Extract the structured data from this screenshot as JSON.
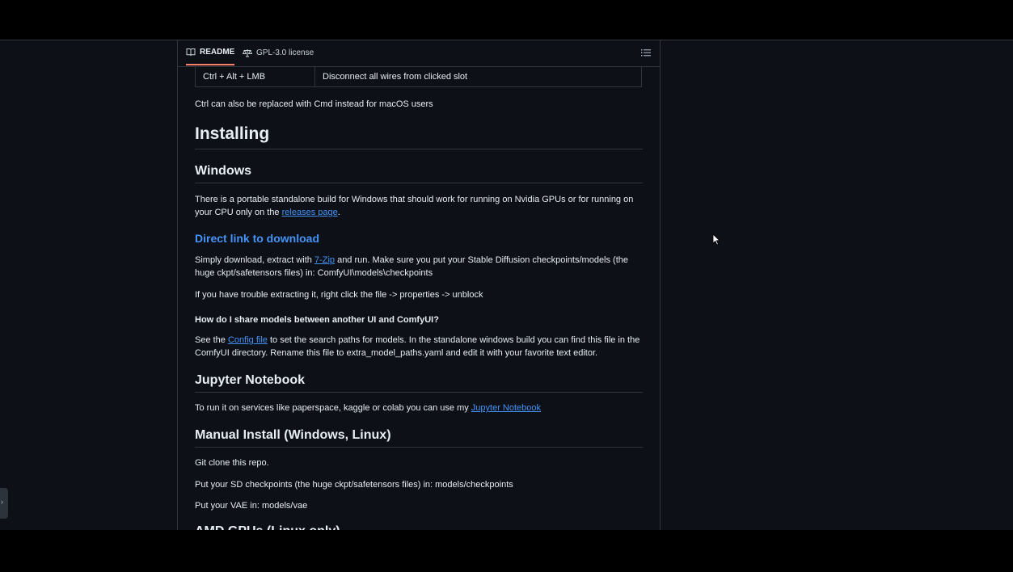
{
  "tabs": {
    "readme_label": "README",
    "license_label": "GPL-3.0 license"
  },
  "shortcut_row": {
    "key": "Ctrl + Alt + LMB",
    "description": "Disconnect all wires from clicked slot"
  },
  "readme": {
    "ctrl_note": "Ctrl can also be replaced with Cmd instead for macOS users",
    "installing_heading": "Installing",
    "windows_heading": "Windows",
    "windows_text_1": "There is a portable standalone build for Windows that should work for running on Nvidia GPUs or for running on your CPU only on the ",
    "releases_link": "releases page",
    "windows_text_end": ".",
    "direct_link_heading": "Direct link to download",
    "download_text_1": "Simply download, extract with ",
    "zip_link": "7-Zip",
    "download_text_2": " and run. Make sure you put your Stable Diffusion checkpoints/models (the huge ckpt/safetensors files) in: ComfyUI\\models\\checkpoints",
    "trouble_text": "If you have trouble extracting it, right click the file -> properties -> unblock",
    "share_heading": "How do I share models between another UI and ComfyUI?",
    "config_text_1": "See the ",
    "config_link": "Config file",
    "config_text_2": " to set the search paths for models. In the standalone windows build you can find this file in the ComfyUI directory. Rename this file to extra_model_paths.yaml and edit it with your favorite text editor.",
    "jupyter_heading": "Jupyter Notebook",
    "jupyter_text": "To run it on services like paperspace, kaggle or colab you can use my ",
    "jupyter_link": "Jupyter Notebook",
    "manual_heading": "Manual Install (Windows, Linux)",
    "git_clone": "Git clone this repo.",
    "checkpoints_text": "Put your SD checkpoints (the huge ckpt/safetensors files) in: models/checkpoints",
    "vae_text": "Put your VAE in: models/vae",
    "next_heading_partial": "AMD GPUs (Linux only)"
  },
  "colors": {
    "background": "#0d1117",
    "border": "#30363d",
    "link": "#4493f8",
    "active_tab_underline": "#f78166",
    "text": "#e6edf3"
  },
  "icons": {
    "readme": "book-icon",
    "license": "scale-icon",
    "outline": "list-icon",
    "side": "chevron-right-icon",
    "pointer": "mouse-cursor-icon"
  }
}
